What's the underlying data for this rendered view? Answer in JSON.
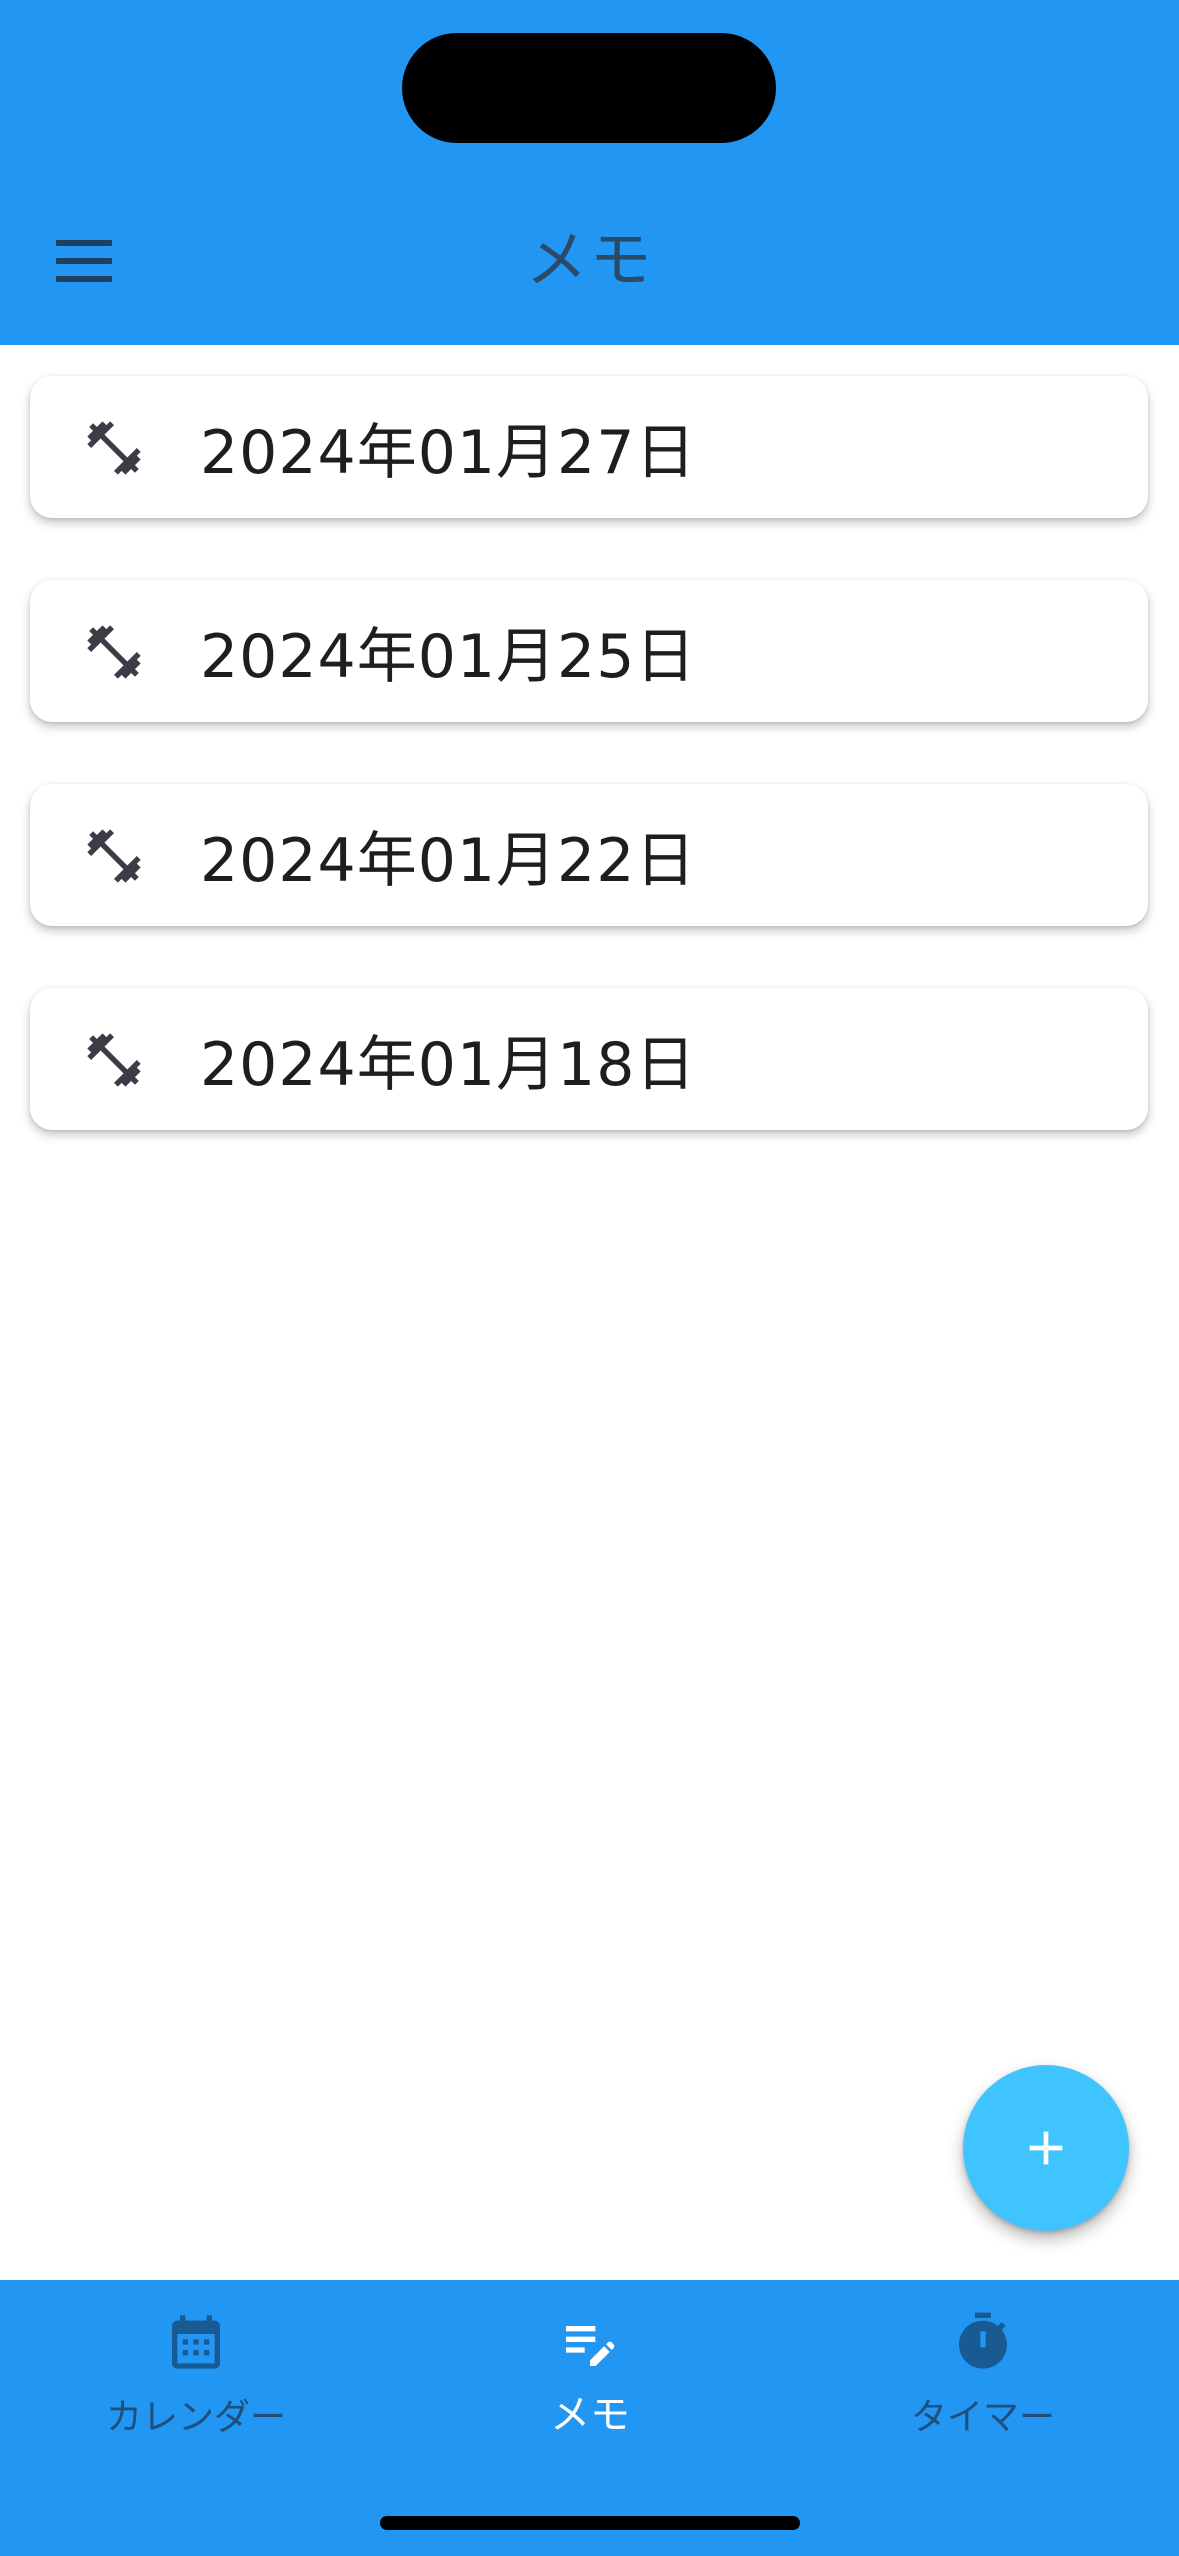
{
  "header": {
    "title": "メモ",
    "menu_icon": "hamburger-menu-icon"
  },
  "memos": [
    {
      "date": "2024年01月27日",
      "icon": "fitness-dumbbell-icon"
    },
    {
      "date": "2024年01月25日",
      "icon": "fitness-dumbbell-icon"
    },
    {
      "date": "2024年01月22日",
      "icon": "fitness-dumbbell-icon"
    },
    {
      "date": "2024年01月18日",
      "icon": "fitness-dumbbell-icon"
    }
  ],
  "fab": {
    "icon": "plus-icon"
  },
  "bottom_nav": {
    "items": [
      {
        "label": "カレンダー",
        "icon": "calendar-icon",
        "active": false
      },
      {
        "label": "メモ",
        "icon": "edit-note-icon",
        "active": true
      },
      {
        "label": "タイマー",
        "icon": "stopwatch-icon",
        "active": false
      }
    ]
  },
  "colors": {
    "app_bar": "#2196f3",
    "fab": "#40c4ff",
    "nav_active": "#ffffff",
    "nav_inactive": "#1f4f7a"
  }
}
